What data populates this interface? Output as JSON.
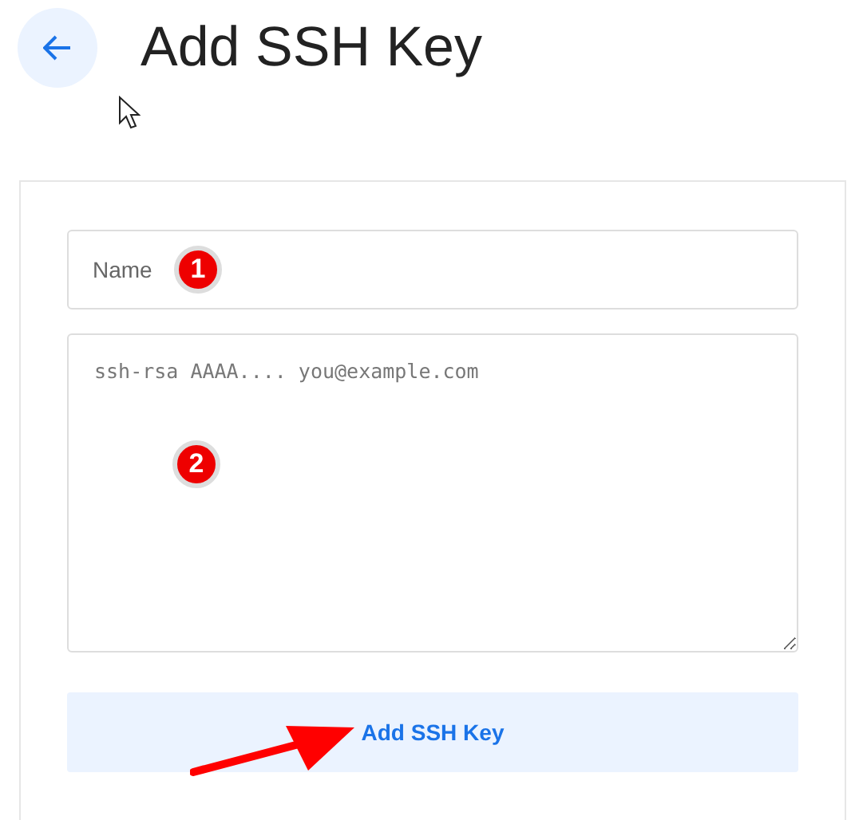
{
  "header": {
    "title": "Add SSH Key"
  },
  "form": {
    "name_field": {
      "placeholder": "Name"
    },
    "key_field": {
      "placeholder": "ssh-rsa AAAA.... you@example.com"
    },
    "submit_button": "Add SSH Key"
  },
  "annotations": [
    {
      "label": "1"
    },
    {
      "label": "2"
    }
  ]
}
